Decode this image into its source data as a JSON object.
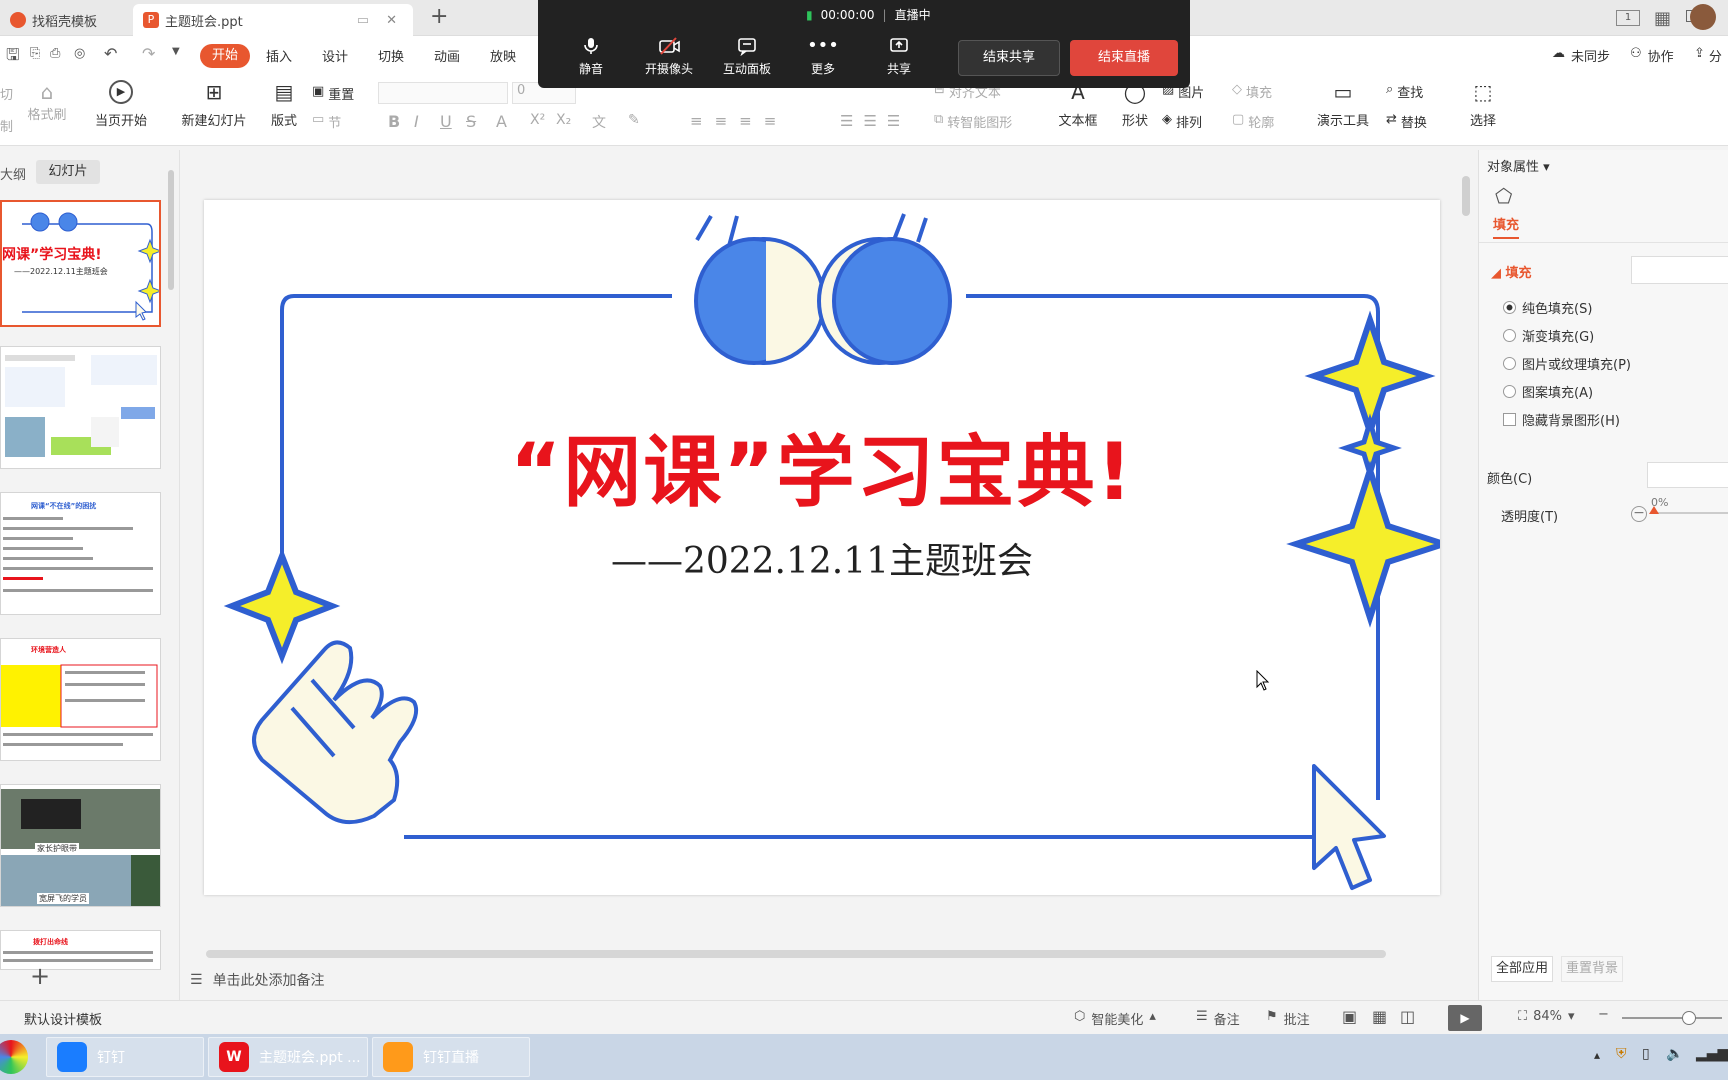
{
  "titlebar": {
    "tabs": [
      {
        "label": "找稻壳模板"
      },
      {
        "label": "主题班会.ppt"
      }
    ],
    "add_tab": "+"
  },
  "live": {
    "timer": "00:00:00",
    "status": "直播中",
    "buttons": [
      "静音",
      "开摄像头",
      "互动面板",
      "更多",
      "共享"
    ],
    "end_share": "结束共享",
    "end_live": "结束直播"
  },
  "ribbon_tabs": [
    "开始",
    "插入",
    "设计",
    "切换",
    "动画",
    "放映"
  ],
  "header_right": {
    "sync": "未同步",
    "collab": "协作",
    "share": "分"
  },
  "ribbon": {
    "cut": "切",
    "format_painter": "格式刷",
    "paste_label": "制",
    "play_from_current": "当页开始",
    "new_slide": "新建幻灯片",
    "layout": "版式",
    "reset": "重置",
    "section": "节",
    "font_size": "0",
    "align_text": "对齐文本",
    "smart_graphic": "转智能图形",
    "textbox": "文本框",
    "shape": "形状",
    "picture": "图片",
    "arrange": "排列",
    "fill": "填充",
    "outline": "轮廓",
    "presenter": "演示工具",
    "find": "查找",
    "replace": "替换",
    "select": "选择"
  },
  "leftpane": {
    "outline_tab": "大纲",
    "slides_tab": "幻灯片",
    "thumb1_title": "网课”学习宝典!",
    "thumb1_sub": "——2022.12.11主题班会",
    "thumb3_title": "网课“不在线”的困扰",
    "thumb4_title": "环境营造人",
    "thumb5_cap1": "家长护眼带",
    "thumb5_cap2": "宽屏飞的学员",
    "thumb6_title": "拨打出命线",
    "add": "+"
  },
  "slide": {
    "title": "“网课”学习宝典!",
    "subtitle": "——2022.12.11主题班会"
  },
  "notes_placeholder": "单击此处添加备注",
  "rightpane": {
    "header": "对象属性",
    "fill_tab": "填充",
    "fill_section": "填充",
    "options": [
      "纯色填充(S)",
      "渐变填充(G)",
      "图片或纹理填充(P)",
      "图案填充(A)"
    ],
    "hide_bg": "隐藏背景图形(H)",
    "color_label": "颜色(C)",
    "transparency_label": "透明度(T)",
    "transparency_value": "0%",
    "apply_all": "全部应用",
    "reset_bg": "重置背景"
  },
  "statusbar": {
    "template": "默认设计模板",
    "beautify": "智能美化",
    "notes": "备注",
    "comment": "批注",
    "zoom": "84%"
  },
  "taskbar": {
    "items": [
      "钉钉",
      "主题班会.ppt ...",
      "钉钉直播"
    ]
  },
  "colors": {
    "accent": "#e8572f",
    "slide_blue": "#2f5fd0",
    "slide_red": "#e8141c",
    "star_yellow": "#f5ee2a",
    "end_live": "#e0463c"
  }
}
